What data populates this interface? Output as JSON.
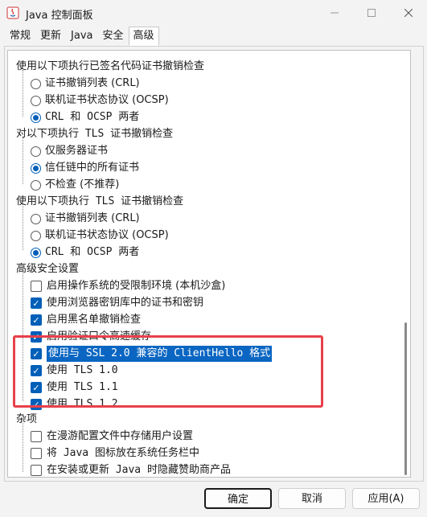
{
  "window": {
    "title": "Java 控制面板",
    "minimize_icon": "minimize-icon",
    "maximize_icon": "maximize-icon",
    "close_icon": "close-icon"
  },
  "tabs": [
    {
      "label": "常规"
    },
    {
      "label": "更新"
    },
    {
      "label": "Java"
    },
    {
      "label": "安全"
    },
    {
      "label": "高级",
      "active": true
    }
  ],
  "groups": {
    "signed_code": {
      "title": "使用以下项执行已签名代码证书撤销检查",
      "options": [
        {
          "label": "证书撤销列表 (CRL)",
          "checked": false
        },
        {
          "label": "联机证书状态协议 (OCSP)",
          "checked": false
        },
        {
          "label": "CRL 和 OCSP 两者",
          "checked": true
        }
      ]
    },
    "tls_check_target": {
      "title": "对以下项执行 TLS 证书撤销检查",
      "options": [
        {
          "label": "仅服务器证书",
          "checked": false
        },
        {
          "label": "信任链中的所有证书",
          "checked": true
        },
        {
          "label": "不检查 (不推荐)",
          "checked": false
        }
      ]
    },
    "tls_check_method": {
      "title": "使用以下项执行 TLS 证书撤销检查",
      "options": [
        {
          "label": "证书撤销列表 (CRL)",
          "checked": false
        },
        {
          "label": "联机证书状态协议 (OCSP)",
          "checked": false
        },
        {
          "label": "CRL 和 OCSP 两者",
          "checked": true
        }
      ]
    },
    "advanced_security": {
      "title": "高级安全设置",
      "options": [
        {
          "label": "启用操作系统的受限制环境 (本机沙盒)",
          "checked": false
        },
        {
          "label": "使用浏览器密钥库中的证书和密钥",
          "checked": true
        },
        {
          "label": "启用黑名单撤销检查",
          "checked": true
        },
        {
          "label": "启用验证口令高速缓存",
          "checked": true
        },
        {
          "label": "使用与 SSL 2.0 兼容的 ClientHello 格式",
          "checked": true
        },
        {
          "label": "使用 TLS 1.0",
          "checked": true
        },
        {
          "label": "使用 TLS 1.1",
          "checked": true
        },
        {
          "label": "使用 TLS 1.2",
          "checked": true
        }
      ]
    },
    "misc": {
      "title": "杂项",
      "options": [
        {
          "label": "在漫游配置文件中存储用户设置",
          "checked": false
        },
        {
          "label": "将 Java 图标放在系统任务栏中",
          "checked": false
        },
        {
          "label": "在安装或更新 Java 时隐藏赞助商产品",
          "checked": false
        }
      ]
    }
  },
  "buttons": {
    "ok": "确定",
    "cancel": "取消",
    "apply": "应用(A)"
  },
  "colors": {
    "accent": "#005fb8",
    "highlight": "#e8404a"
  }
}
